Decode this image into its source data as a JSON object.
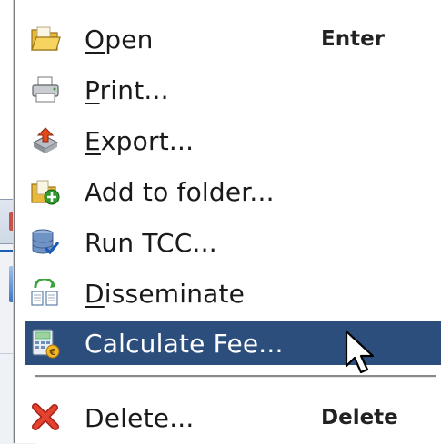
{
  "menu": {
    "items": [
      {
        "label": "Open",
        "mnemonic": "O",
        "rest": "pen",
        "shortcut": "Enter",
        "icon": "folder-open-icon"
      },
      {
        "label": "Print...",
        "mnemonic": "P",
        "rest": "rint...",
        "shortcut": "",
        "icon": "printer-icon"
      },
      {
        "label": "Export...",
        "mnemonic": "E",
        "rest": "xport...",
        "shortcut": "",
        "icon": "export-icon"
      },
      {
        "label": "Add to folder...",
        "mnemonic": "",
        "rest": "Add to folder...",
        "shortcut": "",
        "icon": "add-to-folder-icon"
      },
      {
        "label": "Run TCC...",
        "mnemonic": "",
        "rest": "Run TCC...",
        "shortcut": "",
        "icon": "database-check-icon"
      },
      {
        "label": "Disseminate",
        "mnemonic": "D",
        "rest": "isseminate",
        "shortcut": "",
        "icon": "disseminate-icon"
      },
      {
        "label": "Calculate Fee...",
        "mnemonic": "",
        "rest": "Calculate Fee...",
        "shortcut": "",
        "icon": "calculator-icon"
      },
      {
        "label": "Delete...",
        "mnemonic": "",
        "rest": "Delete...",
        "shortcut": "Delete",
        "icon": "delete-x-icon"
      }
    ],
    "selected_item": "Calculate Fee...",
    "selection_color": "#2c4e7d"
  }
}
